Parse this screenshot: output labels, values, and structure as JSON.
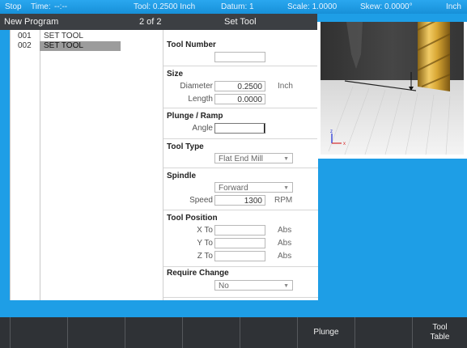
{
  "status": {
    "mode": "Stop",
    "time_label": "Time:",
    "time_value": "--:--",
    "tool": "Tool: 0.2500 Inch",
    "datum": "Datum: 1",
    "scale": "Scale: 1.0000",
    "skew": "Skew: 0.0000°",
    "units": "Inch"
  },
  "header": {
    "program": "New Program",
    "page": "2 of 2",
    "section": "Set Tool"
  },
  "program_list": [
    {
      "num": "001",
      "label": "SET TOOL",
      "selected": false
    },
    {
      "num": "002",
      "label": "SET TOOL",
      "selected": true
    }
  ],
  "form": {
    "tool_number": {
      "title": "Tool Number",
      "value": ""
    },
    "size": {
      "title": "Size",
      "diameter_label": "Diameter",
      "diameter_value": "0.2500",
      "diameter_unit": "Inch",
      "length_label": "Length",
      "length_value": "0.0000"
    },
    "plunge": {
      "title": "Plunge / Ramp",
      "angle_label": "Angle",
      "angle_value": ""
    },
    "tool_type": {
      "title": "Tool Type",
      "value": "Flat End Mill"
    },
    "spindle": {
      "title": "Spindle",
      "direction": "Forward",
      "speed_label": "Speed",
      "speed_value": "1300",
      "speed_unit": "RPM"
    },
    "tool_position": {
      "title": "Tool Position",
      "x_label": "X To",
      "x_value": "",
      "x_unit": "Abs",
      "y_label": "Y To",
      "y_value": "",
      "y_unit": "Abs",
      "z_label": "Z To",
      "z_value": "",
      "z_unit": "Abs"
    },
    "require_change": {
      "title": "Require Change",
      "value": "No"
    }
  },
  "preview": {
    "axis_z": "z",
    "axis_x": "x",
    "tool_color": "#d8a634",
    "accent": "#1e9ee6"
  },
  "softkeys": [
    "",
    "",
    "",
    "",
    "",
    "Plunge",
    "",
    "Tool\nTable"
  ]
}
